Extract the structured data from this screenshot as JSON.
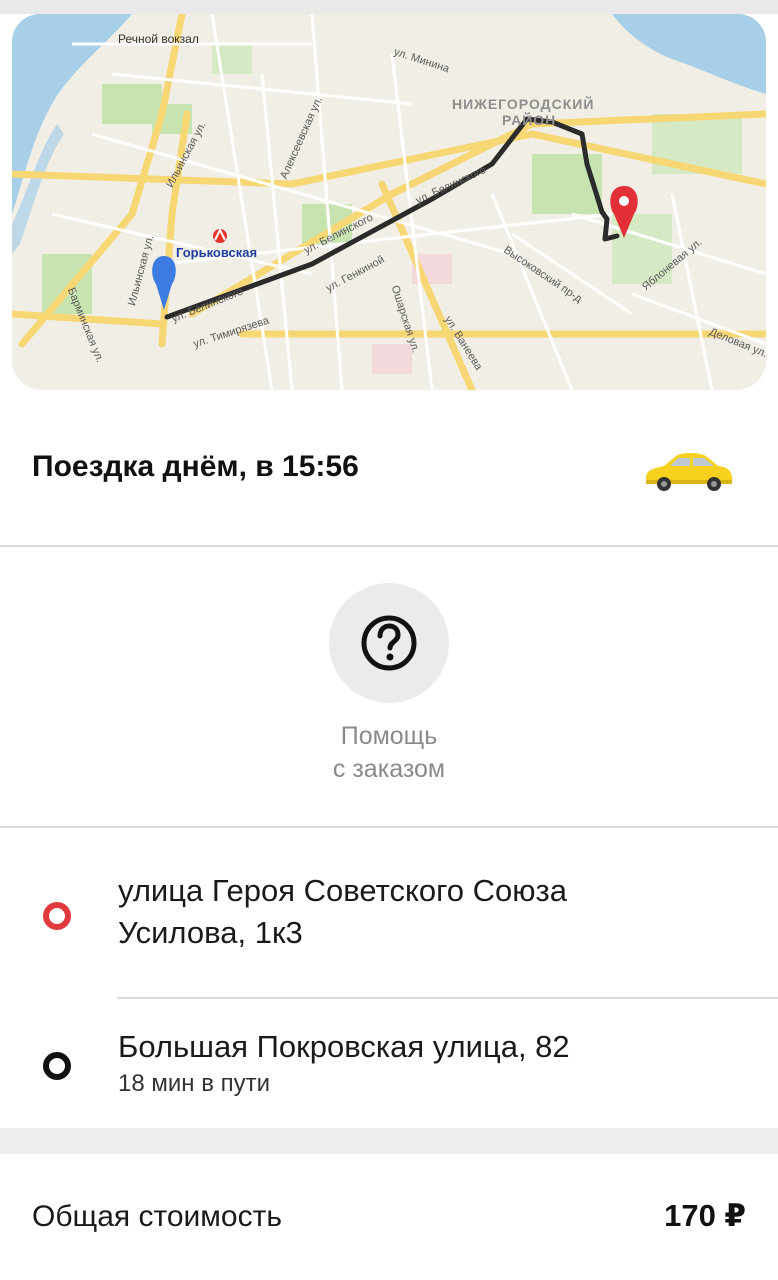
{
  "map": {
    "labels": {
      "river_station": "Речной вокзал",
      "district": "НИЖЕГОРОДСКИЙ",
      "district_line2": "РАЙОН",
      "metro": "Горьковская",
      "streets": [
        "ул. Минина",
        "Ильинская ул.",
        "Алексеевская ул.",
        "Ильинская ул.",
        "Барминская ул.",
        "ул. Белинского",
        "ул. Белинского",
        "ул. Белинского",
        "ул. Генкиной",
        "ул. Тимирязева",
        "Ошарская ул.",
        "ул. Ванеева",
        "Высоковский пр-д",
        "Яблоневая ул.",
        "Деловая ул."
      ]
    },
    "colors": {
      "route": "#2b2b2b",
      "start_pin": "#3c7be0",
      "end_pin": "#e23036",
      "water": "#a8cfe8",
      "park": "#c7e3b0",
      "major_road": "#f7d774"
    }
  },
  "trip": {
    "title": "Поездка днём, в 15:56",
    "vehicle_icon": "taxi-car-icon",
    "vehicle_color": "#f6d11e"
  },
  "help": {
    "icon": "question-circle-icon",
    "label_line1": "Помощь",
    "label_line2": "с заказом"
  },
  "route": {
    "from": {
      "icon": "origin-ring-icon",
      "color": "#e0393e",
      "address_line1": "улица Героя Советского Союза",
      "address_line2": "Усилова, 1к3"
    },
    "to": {
      "icon": "destination-ring-icon",
      "color": "#111111",
      "address": "Большая Покровская улица, 82",
      "duration": "18 мин в пути"
    }
  },
  "cost": {
    "label": "Общая стоимость",
    "value": "170 ₽"
  }
}
